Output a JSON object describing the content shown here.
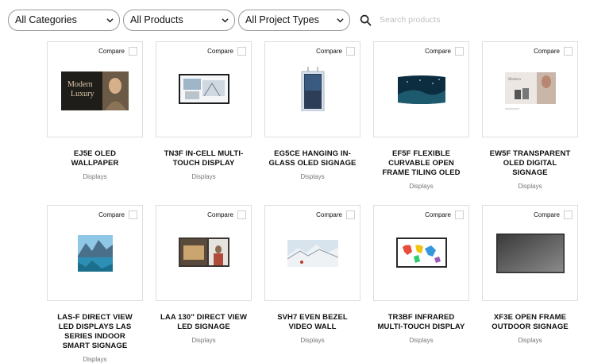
{
  "filters": {
    "category": "All Categories",
    "products": "All Products",
    "project_types": "All Project Types",
    "search_placeholder": "Search products"
  },
  "compare_label": "Compare",
  "products": [
    {
      "name": "EJ5E OLED WALLPAPER",
      "category": "Displays"
    },
    {
      "name": "TN3F IN-CELL MULTI-TOUCH DISPLAY",
      "category": "Displays"
    },
    {
      "name": "EG5CE HANGING IN-GLASS OLED SIGNAGE",
      "category": "Displays"
    },
    {
      "name": "EF5F FLEXIBLE CURVABLE OPEN FRAME TILING OLED",
      "category": "Displays"
    },
    {
      "name": "EW5F TRANSPARENT OLED DIGITAL SIGNAGE",
      "category": "Displays"
    },
    {
      "name": "LAS-F DIRECT VIEW LED DISPLAYS LAS SERIES INDOOR SMART SIGNAGE",
      "category": "Displays"
    },
    {
      "name": "LAA 130\" DIRECT VIEW LED SIGNAGE",
      "category": "Displays"
    },
    {
      "name": "SVH7 EVEN BEZEL VIDEO WALL",
      "category": "Displays"
    },
    {
      "name": "TR3BF INFRARED MULTI-TOUCH DISPLAY",
      "category": "Displays"
    },
    {
      "name": "XF3E OPEN FRAME OUTDOOR SIGNAGE",
      "category": "Displays"
    }
  ],
  "thumb_text": {
    "ej5e_line1": "Modern",
    "ej5e_line2": "Luxury",
    "ew5f_text": "Modern"
  }
}
